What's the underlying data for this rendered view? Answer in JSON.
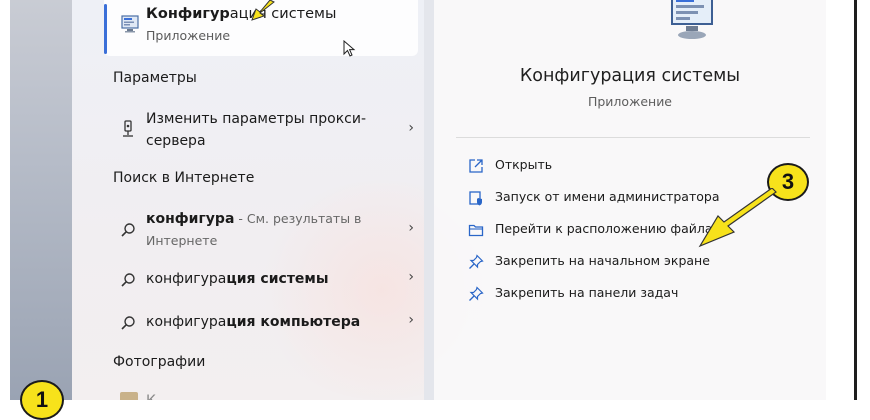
{
  "top_result": {
    "title_bold": "Конфигур",
    "title_rest": "ация системы",
    "subtitle": "Приложение",
    "icon": "system-config-icon"
  },
  "sections": {
    "settings": "Параметры",
    "web": "Поиск в Интернете",
    "photos": "Фотографии"
  },
  "settings_item": {
    "line1": "Изменить параметры прокси-",
    "line2": "сервера",
    "icon": "proxy-settings-icon"
  },
  "web_results": [
    {
      "bold": "конфигура",
      "rest": "",
      "hint": " - См. результаты в",
      "line2": "Интернете"
    },
    {
      "bold": "конфигура",
      "rest": "ция системы"
    },
    {
      "bold": "конфигура",
      "rest": "ция компьютера"
    }
  ],
  "photo_item_partial": "К...",
  "details": {
    "app_name": "Конфигурация системы",
    "app_type": "Приложение",
    "actions": [
      {
        "label": "Открыть",
        "icon": "open-external-icon"
      },
      {
        "label": "Запуск от имени администратора",
        "icon": "run-as-admin-icon"
      },
      {
        "label": "Перейти к расположению файла",
        "icon": "folder-icon"
      },
      {
        "label": "Закрепить на начальном экране",
        "icon": "pin-icon"
      },
      {
        "label": "Закрепить на панели задач",
        "icon": "pin-icon"
      }
    ]
  },
  "annotations": {
    "badge_1": "1",
    "badge_3": "3"
  },
  "colors": {
    "accent": "#3a6fd8",
    "badge": "#f7e21b",
    "action_icon": "#2a66c8"
  }
}
